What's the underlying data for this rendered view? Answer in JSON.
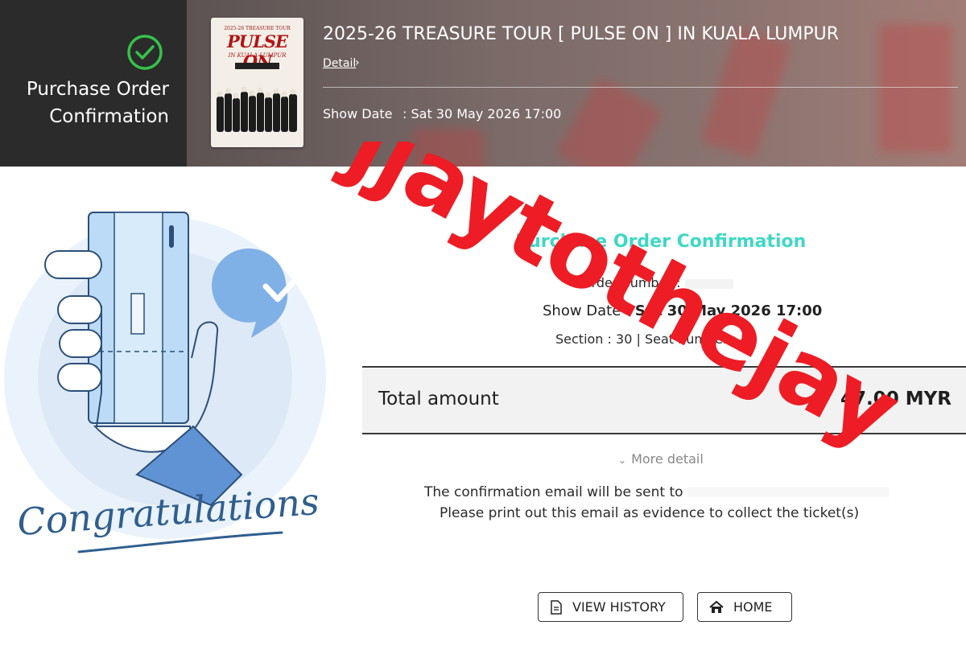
{
  "header": {
    "title_line1": "Purchase Order",
    "title_line2": "Confirmation",
    "poster": {
      "small_text": "2025-26  TREASURE TOUR",
      "big_text": "PULSE ON",
      "sub_text": "IN KUALA LUMPUR"
    },
    "event_title": "2025-26 TREASURE TOUR [ PULSE ON ] IN KUALA LUMPUR",
    "detail_link": "Detail",
    "detail_arrow": "›",
    "show_date_label": "Show Date",
    "show_date_value": ": Sat 30 May 2026 17:00"
  },
  "illustration": {
    "congrats_text": "Congratulations"
  },
  "content": {
    "title": "Purchase Order Confirmation",
    "order_label": "Order number :",
    "show_date_label": "Show Date : ",
    "show_date_value": "Sat 30 May 2026 17:00",
    "section_label": "Section : ",
    "section_value": "30",
    "seat_label": " | Seat number : ",
    "seat_value": "E1",
    "total_label": "Total amount",
    "total_value": "47.00 MYR",
    "more_detail": "More detail",
    "email_line1": "The confirmation email will be sent to",
    "email_line2": "Please print out this email as evidence to collect the ticket(s)"
  },
  "buttons": {
    "view_history": "VIEW HISTORY",
    "home": "HOME"
  },
  "watermark": {
    "text": "jjaytothejay",
    "color": "#ee1c24"
  },
  "colors": {
    "accent": "#3fd8c4",
    "check": "#35c24a",
    "illustration_blue": "#7fb0e6"
  }
}
